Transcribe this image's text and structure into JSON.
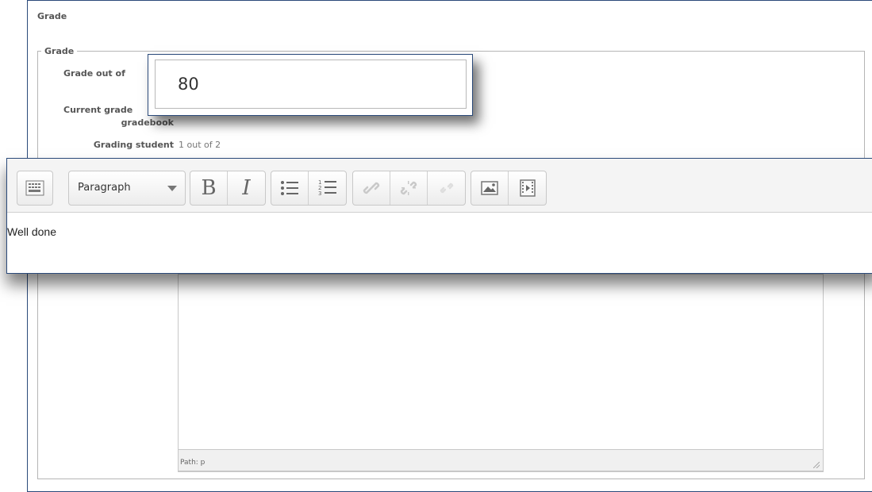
{
  "section": {
    "title": "Grade",
    "fieldset_legend": "Grade"
  },
  "fields": {
    "grade_out_of_label": "Grade out of",
    "grade_value": "80",
    "current_grade_label_line1": "Current grade",
    "current_grade_label_line2": "gradebook",
    "grading_student_label": "Grading student",
    "grading_student_value": "1 out of 2"
  },
  "editor": {
    "format_select": "Paragraph",
    "text": "Well done",
    "path": "Path: p",
    "toolbar_icons": [
      "toolbar-toggle-icon",
      "bold-icon",
      "italic-icon",
      "bullet-list-icon",
      "numbered-list-icon",
      "link-icon",
      "unlink-icon",
      "link-disabled-icon",
      "image-icon",
      "media-icon"
    ]
  },
  "colors": {
    "frame_border": "#2b4a7a",
    "label_text": "#555555"
  }
}
